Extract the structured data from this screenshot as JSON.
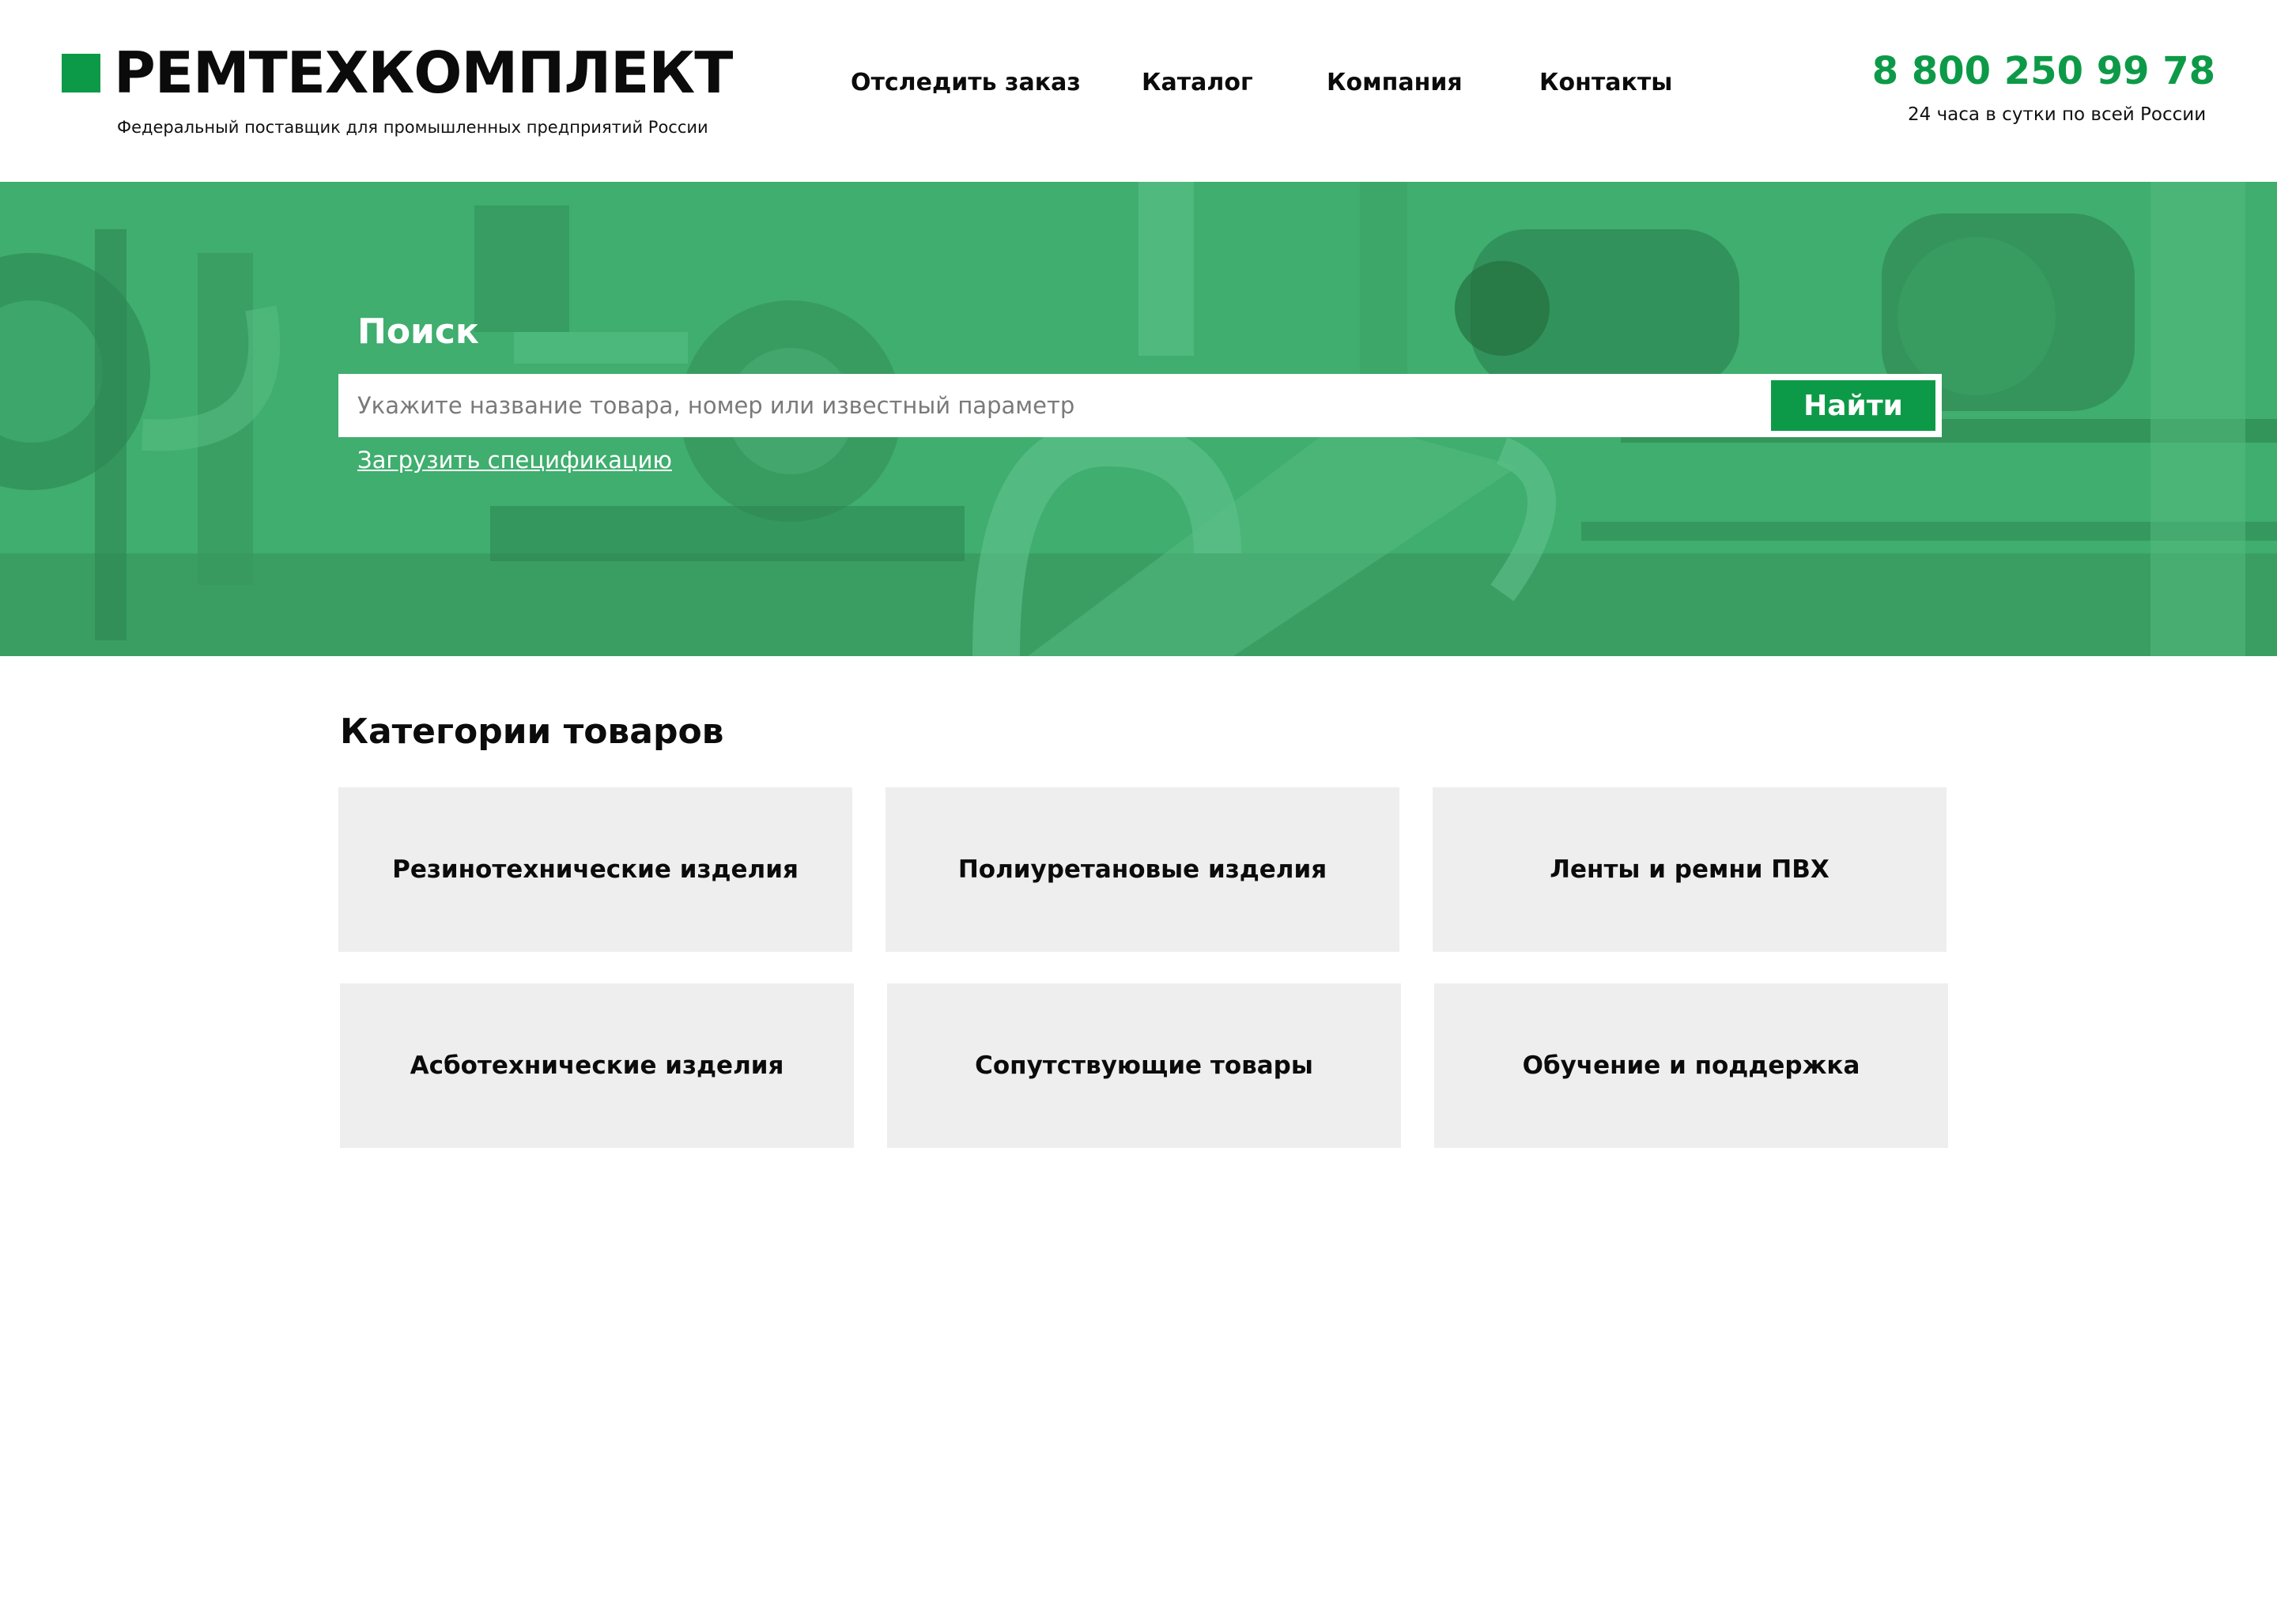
{
  "header": {
    "logo_text": "РЕМТЕХКОМПЛЕКТ",
    "tagline": "Федеральный поставщик для промышленных предприятий России",
    "nav": [
      {
        "label": "Отследить заказ"
      },
      {
        "label": "Каталог"
      },
      {
        "label": "Компания"
      },
      {
        "label": "Контакты"
      }
    ],
    "phone": "8 800 250 99 78",
    "phone_note": "24 часа в сутки по всей России"
  },
  "search": {
    "title": "Поиск",
    "placeholder": "Укажите название товара, номер или известный параметр",
    "button_label": "Найти",
    "spec_link": "Загрузить спецификацию"
  },
  "categories": {
    "title": "Категории товаров",
    "items": [
      {
        "label": "Резинотехнические изделия"
      },
      {
        "label": "Полиуретановые изделия"
      },
      {
        "label": "Ленты и ремни ПВХ"
      },
      {
        "label": "Асботехнические изделия"
      },
      {
        "label": "Сопутствующие товары"
      },
      {
        "label": "Обучение и поддержка"
      }
    ]
  },
  "colors": {
    "brand_green": "#0d9a48",
    "hero_overlay": "#3fae6e",
    "card_bg": "#efeeee"
  }
}
